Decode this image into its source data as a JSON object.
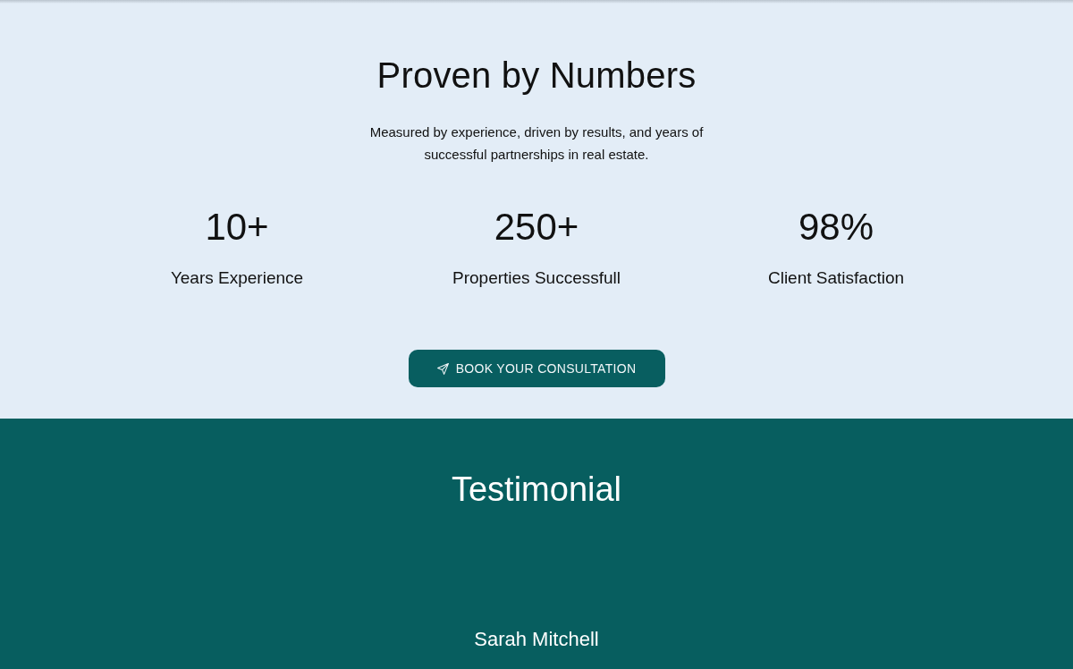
{
  "stats_section": {
    "title": "Proven by Numbers",
    "subtitle": "Measured by experience, driven by results, and years of successful partnerships in real estate.",
    "stats": [
      {
        "value": "10+",
        "label": "Years Experience"
      },
      {
        "value": "250+",
        "label": "Properties Successfull"
      },
      {
        "value": "98%",
        "label": "Client Satisfaction"
      }
    ],
    "button": {
      "label": "BOOK YOUR CONSULTATION"
    }
  },
  "testimonial_section": {
    "title": "Testimonial",
    "name": "Sarah Mitchell"
  }
}
